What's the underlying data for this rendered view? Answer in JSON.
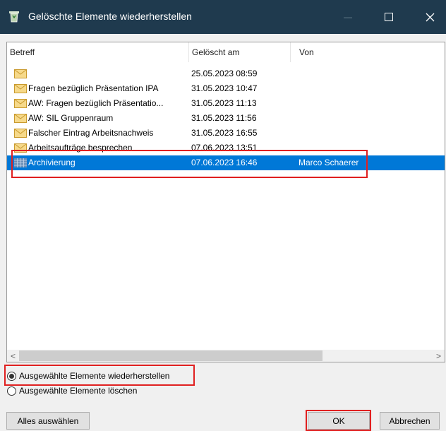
{
  "window": {
    "title": "Gelöschte Elemente wiederherstellen",
    "controls": {
      "minimize": "—",
      "maximize": "☐",
      "close": "✕"
    }
  },
  "columns": [
    "Betreff",
    "Gelöscht am",
    "Von"
  ],
  "rows": [
    {
      "subject": "",
      "deleted": "25.05.2023 08:59",
      "from": "",
      "icon": "envelope-icon"
    },
    {
      "subject": "Fragen bezüglich Präsentation IPA",
      "deleted": "31.05.2023 10:47",
      "from": "",
      "icon": "envelope-icon"
    },
    {
      "subject": "AW: Fragen bezüglich Präsentatio...",
      "deleted": "31.05.2023 11:13",
      "from": "",
      "icon": "envelope-icon"
    },
    {
      "subject": "AW: SIL Gruppenraum",
      "deleted": "31.05.2023 11:56",
      "from": "",
      "icon": "envelope-icon"
    },
    {
      "subject": "Falscher Eintrag Arbeitsnachweis",
      "deleted": "31.05.2023 16:55",
      "from": "",
      "icon": "envelope-icon"
    },
    {
      "subject": "Arbeitsaufträge besprechen",
      "deleted": "07.06.2023 13:51",
      "from": "",
      "icon": "envelope-icon"
    },
    {
      "subject": "Archivierung",
      "deleted": "07.06.2023 16:46",
      "from": "Marco Schaerer",
      "icon": "grid-icon",
      "selected": true
    }
  ],
  "scrollbar": {
    "left": "<",
    "right": ">"
  },
  "options": {
    "restore": "Ausgewählte Elemente wiederherstellen",
    "delete": "Ausgewählte Elemente löschen",
    "selected": "restore"
  },
  "buttons": {
    "select_all": "Alles auswählen",
    "ok": "OK",
    "cancel": "Abbrechen"
  },
  "colors": {
    "titlebar": "#1f3a4e",
    "selection": "#0078d7",
    "highlight": "#e02020",
    "envelope": "#e8c15a"
  }
}
